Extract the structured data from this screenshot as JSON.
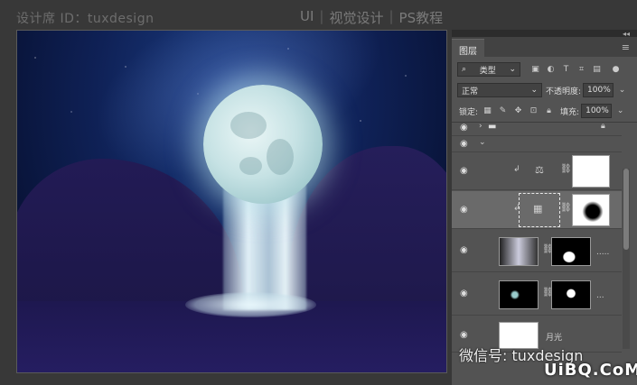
{
  "watermark_top": "设计席 ID：tuxdesign",
  "site_title": [
    "UI",
    "视觉设计",
    "PS教程"
  ],
  "panel": {
    "tab": "图层",
    "filter_label": "类型",
    "blend_mode": "正常",
    "opacity_label": "不透明度:",
    "opacity_value": "100%",
    "lock_label": "锁定:",
    "fill_label": "填充:",
    "fill_value": "100%"
  },
  "layers": [
    {
      "name": "",
      "type": "group-collapsed"
    },
    {
      "name": "",
      "type": "group-expanded"
    },
    {
      "name": "",
      "type": "adjustment-balance"
    },
    {
      "name": "",
      "type": "adjustment-selected"
    },
    {
      "name": ".....",
      "type": "image-mask"
    },
    {
      "name": "...",
      "type": "image-mask"
    },
    {
      "name": "月光",
      "type": "image"
    }
  ],
  "watermark_bottom": "微信号: tuxdesign",
  "watermark_logo": "UiBQ.CoM"
}
